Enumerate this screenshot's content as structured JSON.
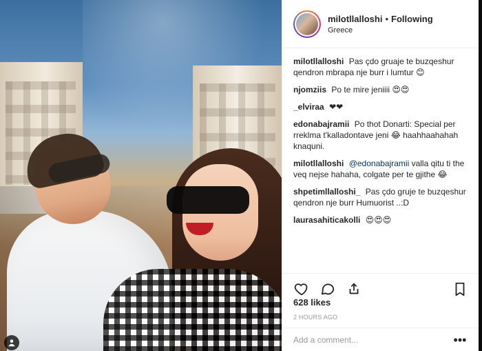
{
  "post": {
    "username": "milotllalloshi",
    "follow_status": "Following",
    "separator": "•",
    "location": "Greece",
    "likes": "628 likes",
    "time_ago": "2 HOURS AGO",
    "add_comment_placeholder": "Add a comment...",
    "more_label": "•••",
    "comments": [
      {
        "user": "milotllalloshi",
        "text": "Pas çdo gruaje te buzqeshur qendron mbrapa nje burr i lumtur ",
        "emoji": "😊"
      },
      {
        "user": "njomziis",
        "text": "Po te mire jeniiii ",
        "emoji": "😍😍"
      },
      {
        "user": "_elviraa",
        "text": "",
        "emoji": "❤❤"
      },
      {
        "user": "edonabajramii",
        "text": "Po thot Donarti: Special per rreklma t'kalladontave jeni ",
        "emoji": "😂",
        "text_after": " haahhaahahah knaquni."
      },
      {
        "user": "milotllalloshi",
        "mention": "@edonabajramii",
        "text": " valla qitu ti the veq nejse hahaha, colgate per te gjithe ",
        "emoji": "😂"
      },
      {
        "user": "shpetimllalloshi_",
        "text": "Pas çdo gruje te buzqeshur qendron nje burr Humuorist ..:D",
        "emoji": ""
      },
      {
        "user": "laurasahiticakolli",
        "text": "",
        "emoji": "😍😍😍"
      }
    ]
  },
  "icons": {
    "like": "heart-icon",
    "comment": "comment-icon",
    "share": "share-icon",
    "save": "bookmark-icon",
    "tag": "user-tag-icon"
  },
  "colors": {
    "border": "#efefef",
    "text": "#262626",
    "muted": "#999999",
    "mention": "#003569"
  }
}
